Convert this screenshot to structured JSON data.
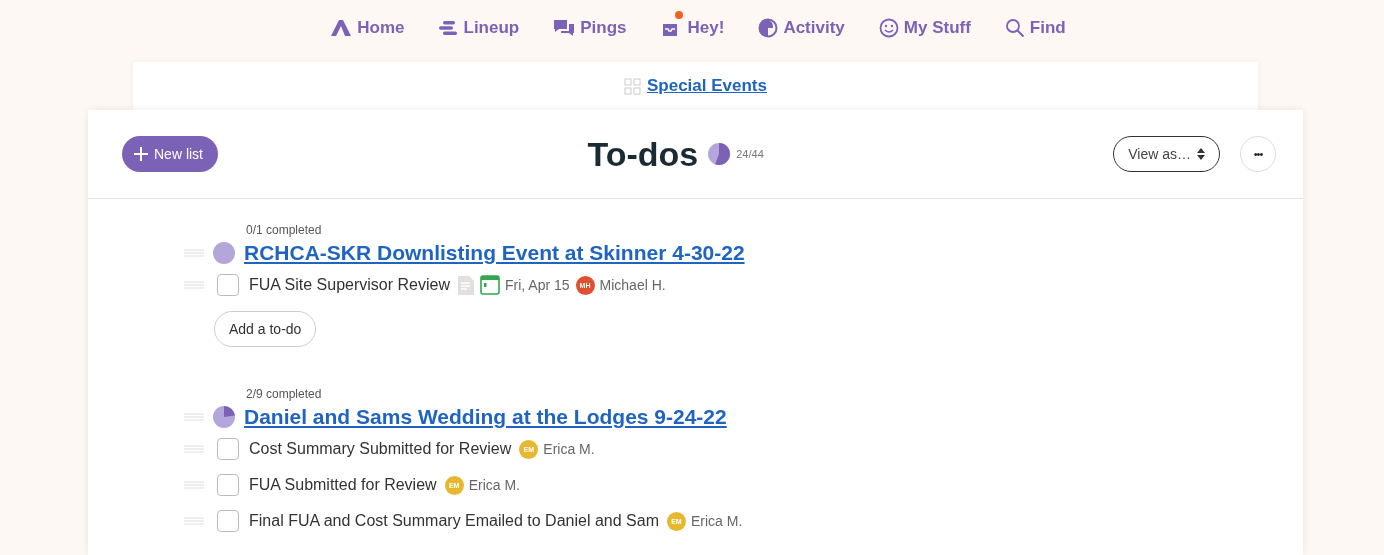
{
  "nav": [
    {
      "label": "Home",
      "notify": false
    },
    {
      "label": "Lineup",
      "notify": false
    },
    {
      "label": "Pings",
      "notify": false
    },
    {
      "label": "Hey!",
      "notify": true
    },
    {
      "label": "Activity",
      "notify": false
    },
    {
      "label": "My Stuff",
      "notify": false
    },
    {
      "label": "Find",
      "notify": false
    }
  ],
  "project": {
    "name": "Special Events"
  },
  "header": {
    "new_button": "New list",
    "title": "To-dos",
    "level": 0.545,
    "progress": "24/44",
    "view_button": "View as…",
    "more_button": "•••"
  },
  "lists": [
    {
      "summary": "0/1 completed",
      "title": "RCHCA-SKR Downlisting Event at Skinner 4-30-22",
      "level": 0,
      "todos": [
        {
          "text": "FUA Site Supervisor Review",
          "checked": false,
          "has_notes": true,
          "due": "Fri, Apr 15",
          "initials": "MH",
          "assignee": "Michael H.",
          "color": "#e0502e"
        }
      ],
      "add_button": "Add a to-do"
    },
    {
      "summary": "2/9 completed",
      "title": "Daniel and Sams Wedding at the Lodges 9-24-22",
      "level": 0.22,
      "todos": [
        {
          "text": "Cost Summary Submitted for Review",
          "checked": false,
          "has_notes": false,
          "initials": "EM",
          "assignee": "Erica M.",
          "color": "#e8b730"
        },
        {
          "text": "FUA Submitted for Review",
          "checked": false,
          "has_notes": false,
          "initials": "EM",
          "assignee": "Erica M.",
          "color": "#e8b730"
        },
        {
          "text": "Final FUA and Cost Summary Emailed to Daniel and Sam",
          "checked": false,
          "has_notes": false,
          "initials": "EM",
          "assignee": "Erica M.",
          "color": "#e8b730"
        }
      ]
    }
  ]
}
